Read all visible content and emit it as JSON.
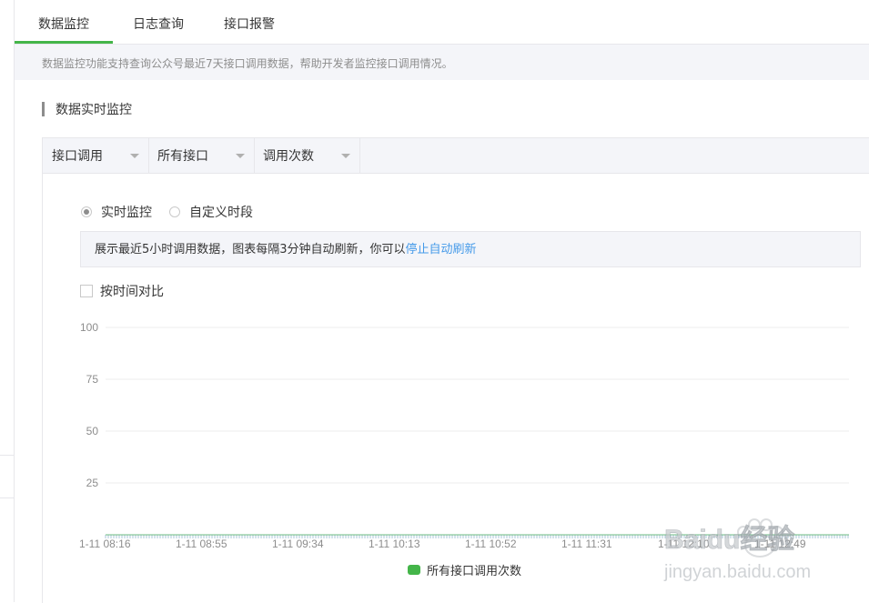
{
  "tabs": [
    {
      "label": "数据监控",
      "active": true
    },
    {
      "label": "日志查询",
      "active": false
    },
    {
      "label": "接口报警",
      "active": false
    }
  ],
  "notice": "数据监控功能支持查询公众号最近7天接口调用数据，帮助开发者监控接口调用情况。",
  "section_title": "数据实时监控",
  "filters": [
    {
      "selected": "接口调用"
    },
    {
      "selected": "所有接口"
    },
    {
      "selected": "调用次数"
    }
  ],
  "mode": {
    "realtime_label": "实时监控",
    "custom_label": "自定义时段",
    "selected": "realtime"
  },
  "info": {
    "text": "展示最近5小时调用数据，图表每隔3分钟自动刷新，你可以",
    "link": "停止自动刷新"
  },
  "compare_label": "按时间对比",
  "colors": {
    "accent": "#44b549",
    "link": "#459ae9",
    "series": "#44b549",
    "baseline": "#a9c4d8"
  },
  "watermark": {
    "brand": "Baidu经验",
    "url": "jingyan.baidu.com"
  },
  "chart_data": {
    "type": "line",
    "y_ticks": [
      100,
      75,
      50,
      25
    ],
    "ylim": [
      0,
      100
    ],
    "x_tick_labels": [
      "1-11 08:16",
      "1-11 08:55",
      "1-11 09:34",
      "1-11 10:13",
      "1-11 10:52",
      "1-11 11:31",
      "1-11 12:10",
      "1-11 12:49"
    ],
    "series": [
      {
        "name": "所有接口调用次数",
        "values": [
          0,
          0,
          0,
          0,
          0,
          0,
          0,
          0
        ]
      }
    ],
    "grid": true,
    "legend": "bottom-center"
  }
}
